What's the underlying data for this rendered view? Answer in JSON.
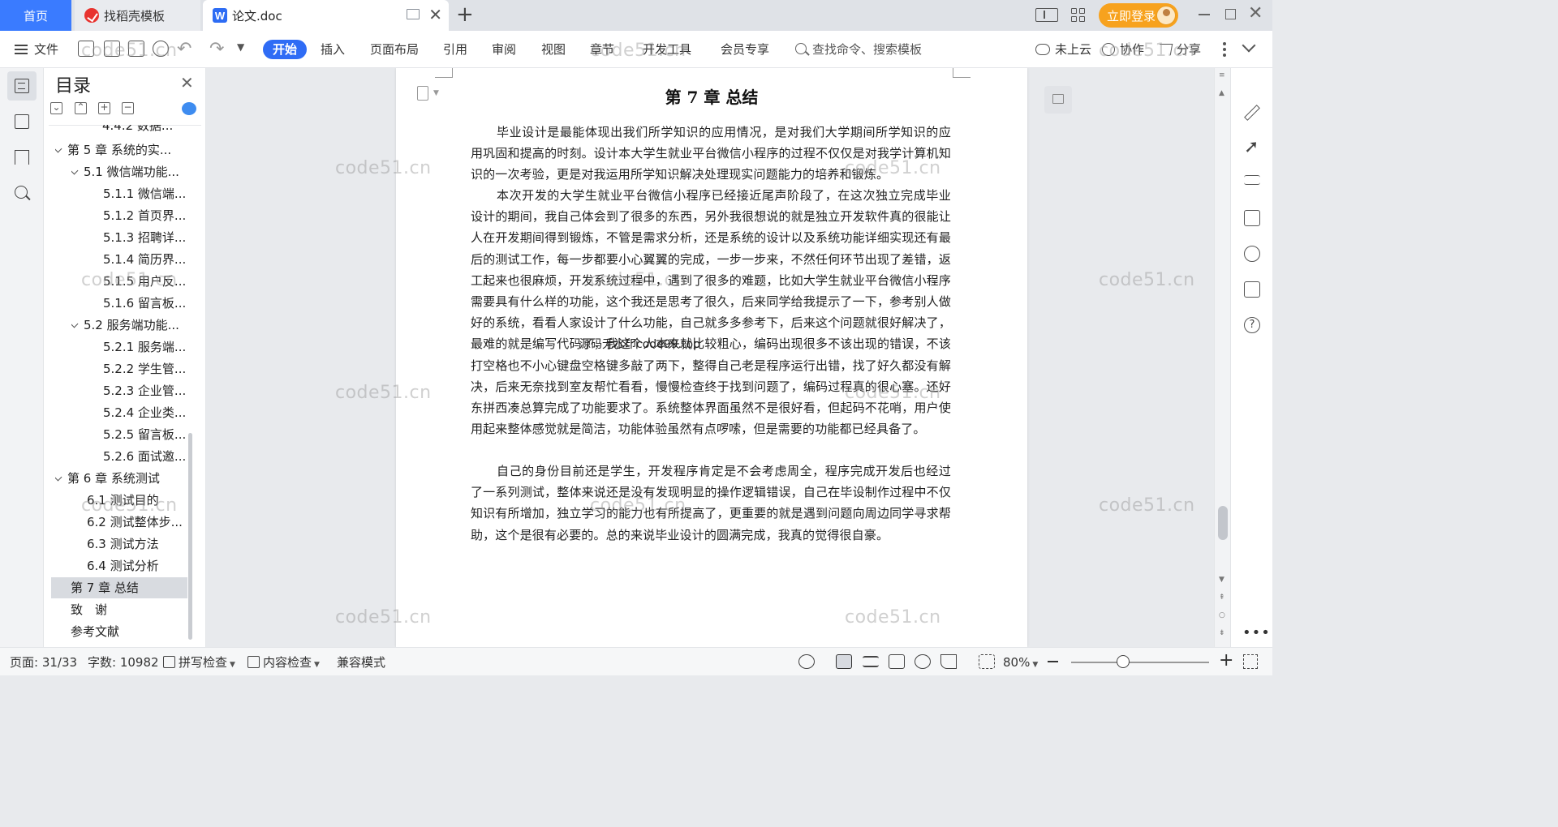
{
  "tabs": {
    "home": "首页",
    "template": "找稻壳模板",
    "document": "论文.doc"
  },
  "account": {
    "login": "立即登录"
  },
  "ribbon": {
    "file": "文件",
    "tabs": [
      "开始",
      "插入",
      "页面布局",
      "引用",
      "审阅",
      "视图",
      "章节",
      "开发工具",
      "会员专享"
    ],
    "search_placeholder": "查找命令、搜索模板",
    "cloud": "未上云",
    "collab": "协作",
    "share": "分享"
  },
  "toc": {
    "title": "目录",
    "items": [
      "4.4.2 数据...",
      "第 5 章 系统的实...",
      "5.1 微信端功能...",
      "5.1.1 微信端...",
      "5.1.2 首页界...",
      "5.1.3 招聘详...",
      "5.1.4 简历界...",
      "5.1.5 用户反...",
      "5.1.6 留言板...",
      "5.2 服务端功能...",
      "5.2.1 服务端...",
      "5.2.2 学生管...",
      "5.2.3 企业管...",
      "5.2.4 企业类...",
      "5.2.5 留言板...",
      "5.2.6 面试邀...",
      "第 6 章 系统测试",
      "6.1 测试目的",
      "6.2 测试整体步...",
      "6.3 测试方法",
      "6.4 测试分析",
      "第 7 章 总结",
      "致　谢",
      "参考文献"
    ],
    "selected": "第 7 章 总结"
  },
  "document": {
    "chapter_title": "第 7 章  总结",
    "paragraphs": [
      "毕业设计是最能体现出我们所学知识的应用情况，是对我们大学期间所学知识的应用巩固和提高的时刻。设计本大学生就业平台微信小程序的过程不仅仅是对我学计算机知识的一次考验，更是对我运用所学知识解决处理现实问题能力的培养和锻炼。",
      "本次开发的大学生就业平台微信小程序已经接近尾声阶段了，在这次独立完成毕业设计的期间，我自己体会到了很多的东西，另外我很想说的就是独立开发软件真的很能让人在开发期间得到锻炼，不管是需求分析，还是系统的设计以及系统功能详细实现还有最后的测试工作，每一步都要小心翼翼的完成，一步一步来，不然任何环节出现了差错，返工起来也很麻烦，开发系统过程中，遇到了很多的难题，比如大学生就业平台微信小程序需要具有什么样的功能，这个我还是思考了很久，后来同学给我提示了一下，参考别人做好的系统，看看人家设计了什么功能，自己就多多参考下，后来这个问题就很好解决了，最难的就是编写代码了，我这个人本来就比较粗心，编码出现很多不该出现的错误，不该打空格也不小心键盘空格键多敲了两下，整得自己老是程序运行出错，找了好久都没有解决，后来无奈找到室友帮忙看看，慢慢检查终于找到问题了，编码过程真的很心塞。还好东拼西凑总算完成了功能要求了。系统整体界面虽然不是很好看，但起码不花哨，用户使用起来整体感觉就是简洁，功能体验虽然有点啰嗦，但是需要的功能都已经具备了。",
      "自己的身份目前还是学生，开发程序肯定是不会考虑周全，程序完成开发后也经过了一系列测试，整体来说还是没有发现明显的操作逻辑错误，自己在毕设制作过程中不仅知识有所增加，独立学习的能力也有所提高了，更重要的就是遇到问题向周边同学寻求帮助，这个是很有必要的。总的来说毕业设计的圆满完成，我真的觉得很自豪。"
    ],
    "overlay": "源码无水印code99.top"
  },
  "watermark": "code51.cn",
  "statusbar": {
    "page": "页面: 31/33",
    "words": "字数: 10982",
    "spell": "拼写检查",
    "content": "内容检查",
    "compat": "兼容模式",
    "zoom": "80%"
  },
  "colors": {
    "accent": "#2f6cf5",
    "login": "#f7a21e",
    "home_tab": "#3a7bff"
  }
}
